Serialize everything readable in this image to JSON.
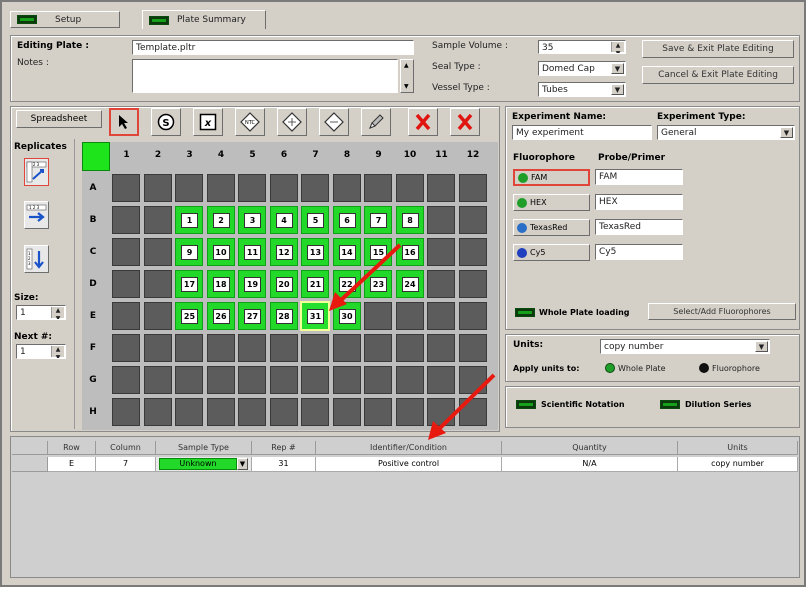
{
  "tabs": {
    "setup": "Setup",
    "plate_summary": "Plate Summary"
  },
  "editing": {
    "plate_label": "Editing Plate :",
    "plate_value": "Template.pltr",
    "notes_label": "Notes :",
    "notes_value": "",
    "sample_volume_label": "Sample Volume :",
    "sample_volume_value": "35",
    "seal_type_label": "Seal Type :",
    "seal_type_value": "Domed Cap",
    "vessel_type_label": "Vessel Type :",
    "vessel_type_value": "Tubes",
    "save_exit": "Save & Exit Plate Editing",
    "cancel_exit": "Cancel & Exit Plate Editing"
  },
  "toolbar": {
    "spreadsheet": "Spreadsheet"
  },
  "left_panel": {
    "replicates": "Replicates",
    "size_label": "Size:",
    "size_value": "1",
    "next_label": "Next #:",
    "next_value": "1"
  },
  "plate": {
    "columns": [
      "1",
      "2",
      "3",
      "4",
      "5",
      "6",
      "7",
      "8",
      "9",
      "10",
      "11",
      "12"
    ],
    "rows": [
      "A",
      "B",
      "C",
      "D",
      "E",
      "F",
      "G",
      "H"
    ],
    "wells": [
      {
        "row": 1,
        "col": 2,
        "label": "1"
      },
      {
        "row": 1,
        "col": 3,
        "label": "2"
      },
      {
        "row": 1,
        "col": 4,
        "label": "3"
      },
      {
        "row": 1,
        "col": 5,
        "label": "4"
      },
      {
        "row": 1,
        "col": 6,
        "label": "5"
      },
      {
        "row": 1,
        "col": 7,
        "label": "6"
      },
      {
        "row": 1,
        "col": 8,
        "label": "7"
      },
      {
        "row": 1,
        "col": 9,
        "label": "8"
      },
      {
        "row": 2,
        "col": 2,
        "label": "9"
      },
      {
        "row": 2,
        "col": 3,
        "label": "10"
      },
      {
        "row": 2,
        "col": 4,
        "label": "11"
      },
      {
        "row": 2,
        "col": 5,
        "label": "12"
      },
      {
        "row": 2,
        "col": 6,
        "label": "13"
      },
      {
        "row": 2,
        "col": 7,
        "label": "14"
      },
      {
        "row": 2,
        "col": 8,
        "label": "15"
      },
      {
        "row": 2,
        "col": 9,
        "label": "16"
      },
      {
        "row": 3,
        "col": 2,
        "label": "17"
      },
      {
        "row": 3,
        "col": 3,
        "label": "18"
      },
      {
        "row": 3,
        "col": 4,
        "label": "19"
      },
      {
        "row": 3,
        "col": 5,
        "label": "20"
      },
      {
        "row": 3,
        "col": 6,
        "label": "21"
      },
      {
        "row": 3,
        "col": 7,
        "label": "22"
      },
      {
        "row": 3,
        "col": 8,
        "label": "23"
      },
      {
        "row": 3,
        "col": 9,
        "label": "24"
      },
      {
        "row": 4,
        "col": 2,
        "label": "25"
      },
      {
        "row": 4,
        "col": 3,
        "label": "26"
      },
      {
        "row": 4,
        "col": 4,
        "label": "27"
      },
      {
        "row": 4,
        "col": 5,
        "label": "28"
      },
      {
        "row": 4,
        "col": 6,
        "label": "31",
        "current": true
      },
      {
        "row": 4,
        "col": 7,
        "label": "30"
      }
    ]
  },
  "experiment": {
    "name_label": "Experiment Name:",
    "name_value": "My experiment",
    "type_label": "Experiment Type:",
    "type_value": "General",
    "fluorophore_header": "Fluorophore",
    "probe_header": "Probe/Primer",
    "fluorophores": [
      {
        "name": "FAM",
        "probe": "FAM",
        "color": "#1f9e2a"
      },
      {
        "name": "HEX",
        "probe": "HEX",
        "color": "#1f9e2a"
      },
      {
        "name": "TexasRed",
        "probe": "TexasRed",
        "color": "#2a6ec7"
      },
      {
        "name": "Cy5",
        "probe": "Cy5",
        "color": "#1f3fbf"
      }
    ],
    "whole_plate_loading": "Whole Plate loading",
    "select_add_fluorophores": "Select/Add Fluorophores"
  },
  "units": {
    "label": "Units:",
    "value": "copy number",
    "apply_label": "Apply units to:",
    "whole_plate": "Whole Plate",
    "fluorophore": "Fluorophore"
  },
  "options": {
    "scientific_notation": "Scientific Notation",
    "dilution_series": "Dilution Series"
  },
  "table": {
    "headers": [
      "Row",
      "Column",
      "Sample Type",
      "Rep #",
      "Identifier/Condition",
      "Quantity",
      "Units"
    ],
    "rows": [
      {
        "row": "E",
        "column": "7",
        "sample_type": "Unknown",
        "rep": "31",
        "identifier": "Positive control",
        "quantity": "N/A",
        "units": "copy number"
      }
    ]
  },
  "colors": {
    "selected_well": "#22d92a",
    "empty_well": "#5c5c5c",
    "annotation_arrow": "#e8190f"
  }
}
